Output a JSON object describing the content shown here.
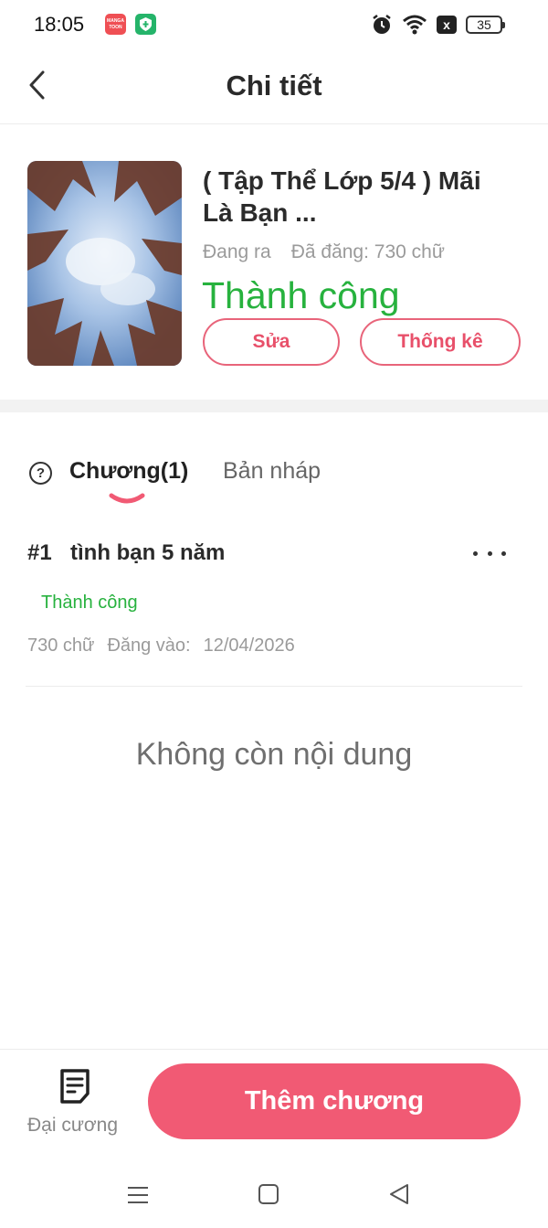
{
  "status_bar": {
    "time": "18:05",
    "manga_badge_text": "MANGA TOON",
    "sim_label": "x",
    "battery": "35",
    "icons": [
      "alarm-icon",
      "wifi-icon",
      "sim-icon",
      "battery-icon"
    ]
  },
  "header": {
    "title": "Chi tiết"
  },
  "book": {
    "title": "( Tập Thể Lớp 5/4 ) Mãi Là Bạn ...",
    "state": "Đang ra",
    "word_count": "Đã đăng: 730 chữ",
    "status": "Thành công",
    "edit_label": "Sửa",
    "stats_label": "Thống kê"
  },
  "tabs": {
    "chapters": "Chương(1)",
    "drafts": "Bản nháp"
  },
  "chapters": [
    {
      "number": "#1",
      "name": "tình bạn 5 năm",
      "status": "Thành công",
      "words": "730 chữ",
      "published_label": "Đăng vào:",
      "date": "12/04/2026"
    }
  ],
  "empty_message": "Không còn nội dung",
  "bottom": {
    "outline_label": "Đại cương",
    "add_chapter_label": "Thêm chương"
  },
  "colors": {
    "accent": "#f15a74",
    "success": "#27b23e"
  }
}
